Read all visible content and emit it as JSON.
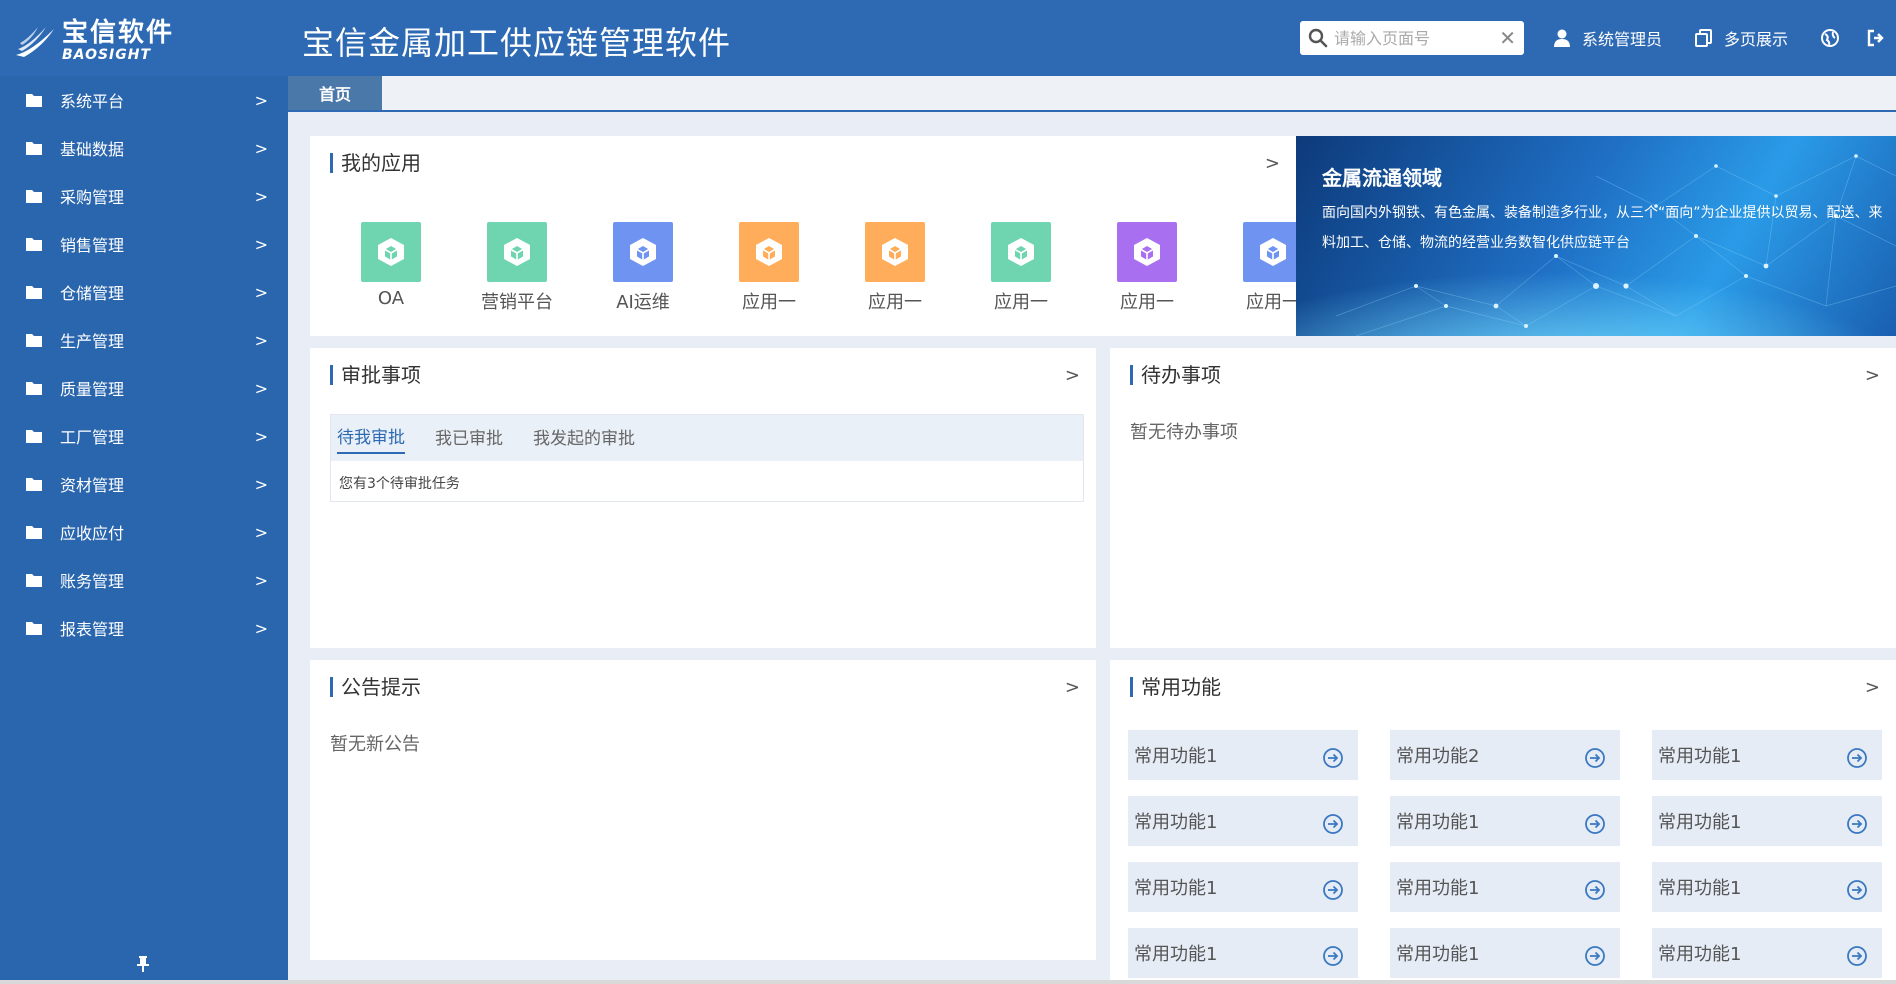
{
  "header": {
    "logo_cn": "宝信软件",
    "logo_en": "BAOSIGHT",
    "app_title": "宝信金属加工供应链管理软件",
    "search_placeholder": "请输入页面号",
    "user_label": "系统管理员",
    "multipage_label": "多页展示",
    "icons": [
      "search-icon",
      "close-icon",
      "user-icon",
      "copy-icon",
      "globe-icon",
      "logout-icon"
    ]
  },
  "sidebar": {
    "items": [
      {
        "label": "系统平台"
      },
      {
        "label": "基础数据"
      },
      {
        "label": "采购管理"
      },
      {
        "label": "销售管理"
      },
      {
        "label": "仓储管理"
      },
      {
        "label": "生产管理"
      },
      {
        "label": "质量管理"
      },
      {
        "label": "工厂管理"
      },
      {
        "label": "资材管理"
      },
      {
        "label": "应收应付"
      },
      {
        "label": "账务管理"
      },
      {
        "label": "报表管理"
      }
    ],
    "chevron": ">"
  },
  "tabs": {
    "home": "首页"
  },
  "my_apps": {
    "title": "我的应用",
    "more": ">",
    "apps": [
      {
        "label": "OA",
        "color": "#6fd5b0"
      },
      {
        "label": "营销平台",
        "color": "#6fd5b0"
      },
      {
        "label": "AI运维",
        "color": "#6f93f0"
      },
      {
        "label": "应用一",
        "color": "#ffad5b"
      },
      {
        "label": "应用一",
        "color": "#ffad5b"
      },
      {
        "label": "应用一",
        "color": "#6fd5b0"
      },
      {
        "label": "应用一",
        "color": "#a86ff0"
      },
      {
        "label": "应用一",
        "color": "#6f93f0"
      }
    ]
  },
  "banner": {
    "title": "金属流通领域",
    "desc": "面向国内外钢铁、有色金属、装备制造多行业，从三个“面向”为企业提供以贸易、配送、来料加工、仓储、物流的经营业务数智化供应链平台"
  },
  "approvals": {
    "title": "审批事项",
    "more": ">",
    "tabs": [
      "待我审批",
      "我已审批",
      "我发起的审批"
    ],
    "message": "您有3个待审批任务"
  },
  "todo": {
    "title": "待办事项",
    "more": ">",
    "empty": "暂无待办事项"
  },
  "notice": {
    "title": "公告提示",
    "more": ">",
    "empty": "暂无新公告"
  },
  "functions": {
    "title": "常用功能",
    "more": ">",
    "items": [
      "常用功能1",
      "常用功能2",
      "常用功能1",
      "常用功能1",
      "常用功能1",
      "常用功能1",
      "常用功能1",
      "常用功能1",
      "常用功能1",
      "常用功能1",
      "常用功能1",
      "常用功能1"
    ]
  },
  "colors": {
    "header": "#2e6ab3",
    "sidebar": "#2a66ae",
    "tab_active": "#4a78a8",
    "accent": "#2e6ab3"
  }
}
